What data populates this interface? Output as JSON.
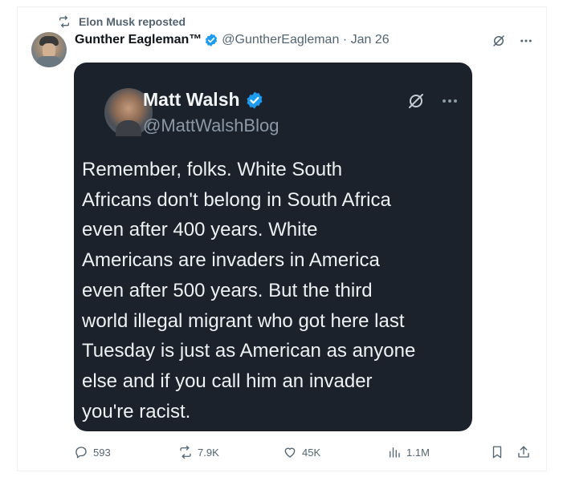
{
  "repost": {
    "text": "Elon Musk reposted"
  },
  "tweet": {
    "author_name": "Gunther Eagleman™",
    "handle_date": "@GuntherEagleman · Jan 26"
  },
  "embedded": {
    "name": "Matt Walsh",
    "handle": "@MattWalshBlog",
    "text": "Remember, folks. White South\nAfricans don't belong in South Africa\neven after 400 years. White\nAmericans are invaders in America\neven after 500 years. But the third\nworld illegal migrant who got here last\nTuesday is just as American as anyone\nelse and if you call him an invader\nyou're racist."
  },
  "actions": {
    "replies": "593",
    "reposts": "7.9K",
    "likes": "45K",
    "views": "1.1M"
  },
  "icons": [
    "repost-icon",
    "verified-badge-icon",
    "grok-icon",
    "more-icon",
    "reply-icon",
    "like-icon",
    "views-icon",
    "bookmark-icon",
    "share-icon"
  ],
  "colors": {
    "verified": "#1d9bf0",
    "muted": "#536471",
    "media_bg": "#1b222c"
  }
}
